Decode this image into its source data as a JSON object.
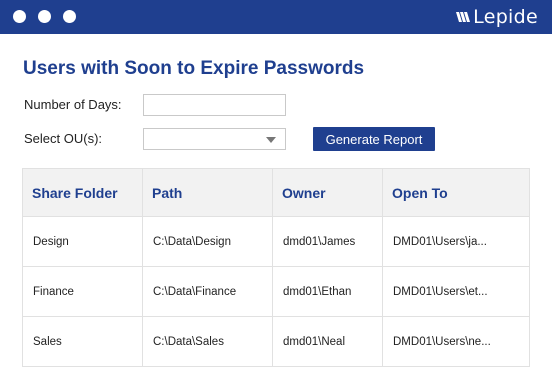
{
  "window": {
    "brand_name": "Lepide"
  },
  "page": {
    "title": "Users with Soon to Expire Passwords"
  },
  "form": {
    "days_label": "Number of Days:",
    "days_value": "",
    "ou_label": "Select OU(s):",
    "ou_value": "",
    "generate_label": "Generate Report"
  },
  "table": {
    "headers": [
      "Share Folder",
      "Path",
      "Owner",
      "Open To"
    ],
    "rows": [
      [
        "Design",
        "C:\\Data\\Design",
        "dmd01\\James",
        "DMD01\\Users\\ja..."
      ],
      [
        "Finance",
        "C:\\Data\\Finance",
        "dmd01\\Ethan",
        "DMD01\\Users\\et..."
      ],
      [
        "Sales",
        "C:\\Data\\Sales",
        "dmd01\\Neal",
        "DMD01\\Users\\ne..."
      ]
    ]
  },
  "colors": {
    "accent": "#1f3f8f",
    "header_bg": "#f2f2f2"
  },
  "icons": [
    "window-dot-icon",
    "lepide-logo-icon",
    "dropdown-caret-icon"
  ]
}
